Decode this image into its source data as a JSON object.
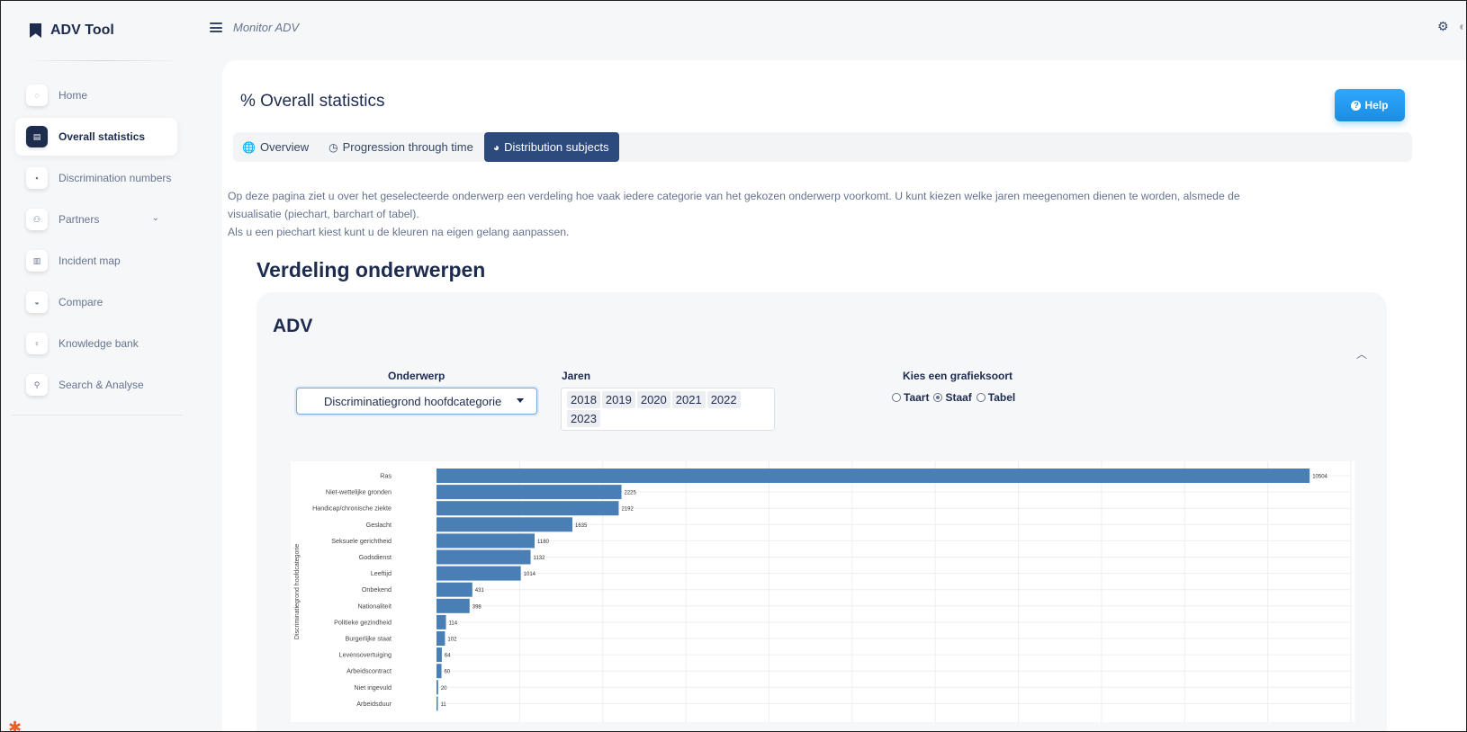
{
  "app": {
    "title": "ADV Tool",
    "section": "Monitor ADV"
  },
  "sidebar": {
    "items": [
      {
        "label": "Home",
        "icon": "home-icon",
        "glyph": "◌",
        "active": false
      },
      {
        "label": "Overall statistics",
        "icon": "stats-icon",
        "glyph": "▤",
        "active": true
      },
      {
        "label": "Discrimination numbers",
        "icon": "file-icon",
        "glyph": "▪",
        "active": false
      },
      {
        "label": "Partners",
        "icon": "partners-icon",
        "glyph": "⚇",
        "active": false,
        "expandable": true
      },
      {
        "label": "Incident map",
        "icon": "map-icon",
        "glyph": "▥",
        "active": false
      },
      {
        "label": "Compare",
        "icon": "compare-icon",
        "glyph": "◒",
        "active": false
      },
      {
        "label": "Knowledge bank",
        "icon": "bulb-icon",
        "glyph": "♀",
        "active": false
      },
      {
        "label": "Search & Analyse",
        "icon": "search-icon",
        "glyph": "⚲",
        "active": false
      }
    ]
  },
  "page": {
    "title": "% Overall statistics",
    "help_label": "Help",
    "tabs": [
      {
        "label": "Overview",
        "icon": "globe-icon",
        "glyph": "🌐",
        "active": false
      },
      {
        "label": "Progression through time",
        "icon": "clock-icon",
        "glyph": "◷",
        "active": false
      },
      {
        "label": "Distribution subjects",
        "icon": "pie-icon",
        "glyph": "◕",
        "active": true
      }
    ],
    "intro_line1": "Op deze pagina ziet u over het geselecteerde onderwerp een verdeling hoe vaak iedere categorie van het gekozen onderwerp voorkomt. U kunt kiezen welke jaren meegenomen dienen te worden, alsmede de",
    "intro_line2": "visualisatie (piechart, barchart of tabel).",
    "intro_line3": "Als u een piechart kiest kunt u de kleuren na eigen gelang aanpassen.",
    "section_title": "Verdeling onderwerpen"
  },
  "panel": {
    "title": "ADV",
    "subject_label": "Onderwerp",
    "subject_value": "Discriminatiegrond hoofdcategorie",
    "years_label": "Jaren",
    "years": [
      "2018",
      "2019",
      "2020",
      "2021",
      "2022",
      "2023"
    ],
    "chart_type_label": "Kies een grafieksoort",
    "chart_types": [
      {
        "label": "Taart",
        "selected": false
      },
      {
        "label": "Staaf",
        "selected": true
      },
      {
        "label": "Tabel",
        "selected": false
      }
    ]
  },
  "chart_data": {
    "type": "bar",
    "orientation": "horizontal",
    "ylabel": "Discriminatiegrond hoofdcategorie",
    "categories": [
      "Ras",
      "Niet-wettelijke gronden",
      "Handicap/chronische ziekte",
      "Geslacht",
      "Seksuele gerichtheid",
      "Godsdienst",
      "Leeftijd",
      "Onbekend",
      "Nationaliteit",
      "Politieke gezindheid",
      "Burgerlijke staat",
      "Levensovertuiging",
      "Arbeidscontract",
      "Niet ingevuld",
      "Arbeidsduur"
    ],
    "values": [
      10504,
      2225,
      2192,
      1635,
      1180,
      1132,
      1014,
      431,
      398,
      114,
      102,
      64,
      60,
      20,
      11
    ],
    "xlim": [
      0,
      11000
    ],
    "grid": true,
    "bar_color": "#4a7fb5"
  }
}
